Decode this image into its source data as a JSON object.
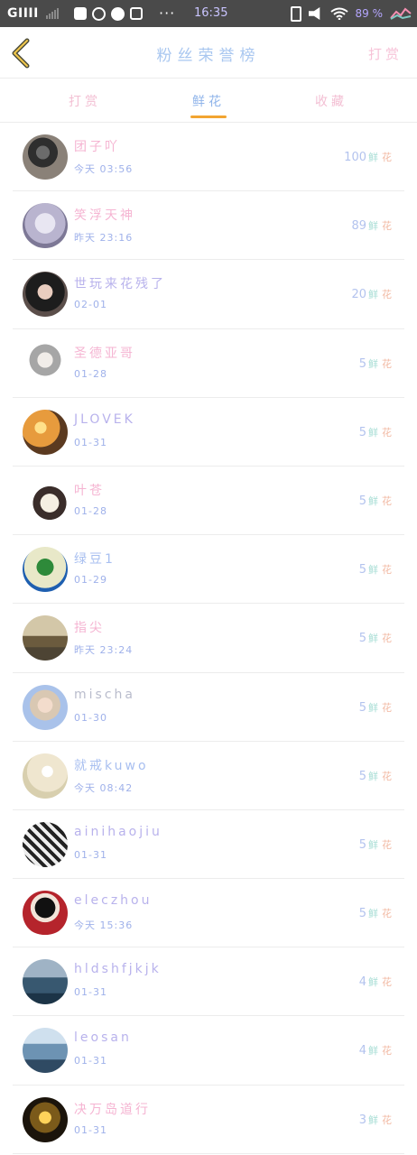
{
  "status_bar": {
    "carrier": "GIIII",
    "time": "16:35",
    "battery": "89 %",
    "icons": [
      "signal-icon",
      "app-icon",
      "qq-icon",
      "chat-icon",
      "screenshot-icon",
      "more-icon",
      "battery-saver-icon",
      "mute-icon",
      "wifi-icon",
      "chart-icon"
    ]
  },
  "header": {
    "title": "粉丝荣誉榜",
    "action": "打赏"
  },
  "tabs": [
    {
      "label": "打赏",
      "active": false
    },
    {
      "label": "鲜花",
      "active": true
    },
    {
      "label": "收藏",
      "active": false
    }
  ],
  "colors": {
    "accent": "#f2a531",
    "tab_active": "#8fb4ea",
    "tab_inactive": "#f3bfd3",
    "time_text": "#9fb1ea"
  },
  "count_unit": [
    "鲜",
    "花"
  ],
  "rows": [
    {
      "name": "团子吖",
      "name_color": "c-pink",
      "time": "今天 03:56",
      "count": "100",
      "avatar": "avatar-girl-dark"
    },
    {
      "name": "笑浮天神",
      "name_color": "c-pink",
      "time": "昨天 23:16",
      "count": "89",
      "avatar": "avatar-anime-white"
    },
    {
      "name": "世玩来花残了",
      "name_color": "c-lav",
      "time": "02-01",
      "count": "20",
      "avatar": "avatar-girl-black-hair"
    },
    {
      "name": "圣德亚哥",
      "name_color": "c-pink",
      "time": "01-28",
      "count": "5",
      "avatar": "avatar-anime-silver"
    },
    {
      "name": "JLOVEK",
      "name_color": "c-lav",
      "time": "01-31",
      "count": "5",
      "avatar": "avatar-sunset"
    },
    {
      "name": "叶苍",
      "name_color": "c-pink",
      "time": "01-28",
      "count": "5",
      "avatar": "avatar-cartoon-couple"
    },
    {
      "name": "绿豆1",
      "name_color": "c-blue",
      "time": "01-29",
      "count": "5",
      "avatar": "avatar-cactus"
    },
    {
      "name": "指尖",
      "name_color": "c-pink",
      "time": "昨天 23:24",
      "count": "5",
      "avatar": "avatar-jeep"
    },
    {
      "name": "mischa",
      "name_color": "c-gray",
      "time": "01-30",
      "count": "5",
      "avatar": "avatar-blonde-girl"
    },
    {
      "name": "就戒kuwo",
      "name_color": "c-blue",
      "time": "今天 08:42",
      "count": "5",
      "avatar": "avatar-dandelion"
    },
    {
      "name": "ainihaojiu",
      "name_color": "c-lav",
      "time": "01-31",
      "count": "5",
      "avatar": "avatar-girl-pattern"
    },
    {
      "name": "eleczhou",
      "name_color": "c-lav",
      "time": "今天 15:36",
      "count": "5",
      "avatar": "avatar-anime-red"
    },
    {
      "name": "hldshfjkjk",
      "name_color": "c-lav",
      "time": "01-31",
      "count": "4",
      "avatar": "avatar-sea-blue"
    },
    {
      "name": "leosan",
      "name_color": "c-lav",
      "time": "01-31",
      "count": "4",
      "avatar": "avatar-sky"
    },
    {
      "name": "决万岛道行",
      "name_color": "c-pink",
      "time": "01-31",
      "count": "3",
      "avatar": "avatar-candles"
    }
  ]
}
